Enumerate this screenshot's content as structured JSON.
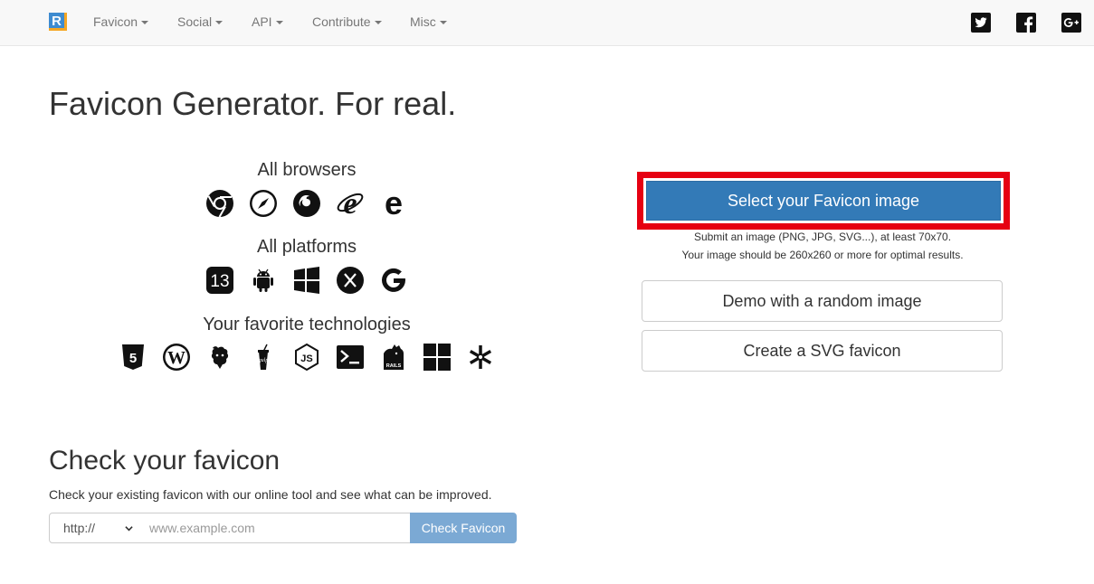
{
  "navbar": {
    "logo_icon": "realfavicongenerator-logo-icon",
    "items": [
      {
        "label": "Favicon"
      },
      {
        "label": "Social"
      },
      {
        "label": "API"
      },
      {
        "label": "Contribute"
      },
      {
        "label": "Misc"
      }
    ],
    "social_icons": [
      "twitter-icon",
      "facebook-icon",
      "google-plus-icon"
    ]
  },
  "hero": {
    "title": "Favicon Generator. For real.",
    "browsers_title": "All browsers",
    "browser_icons": [
      "chrome-icon",
      "safari-icon",
      "firefox-icon",
      "internet-explorer-icon",
      "edge-icon"
    ],
    "platforms_title": "All platforms",
    "platform_icons": [
      "ios-13-icon",
      "android-icon",
      "windows-icon",
      "macos-x-icon",
      "google-icon"
    ],
    "technologies_title": "Your favorite technologies",
    "technology_icons": [
      "html5-icon",
      "wordpress-icon",
      "gulp-icon",
      "grunt-icon",
      "nodejs-icon",
      "cli-icon",
      "rails-icon",
      "windows-tiles-icon",
      "asterisk-icon"
    ]
  },
  "actions": {
    "select_label": "Select your Favicon image",
    "help_line1": "Submit an image (PNG, JPG, SVG...), at least 70x70.",
    "help_line2": "Your image should be 260x260 or more for optimal results.",
    "demo_label": "Demo with a random image",
    "svg_label": "Create a SVG favicon"
  },
  "check": {
    "title": "Check your favicon",
    "description": "Check your existing favicon with our online tool and see what can be improved.",
    "protocol_selected": "http://",
    "url_placeholder": "www.example.com",
    "button_label": "Check Favicon"
  },
  "colors": {
    "primary": "#337ab7",
    "highlight": "#e60012",
    "check_button": "#7ba9d4"
  }
}
